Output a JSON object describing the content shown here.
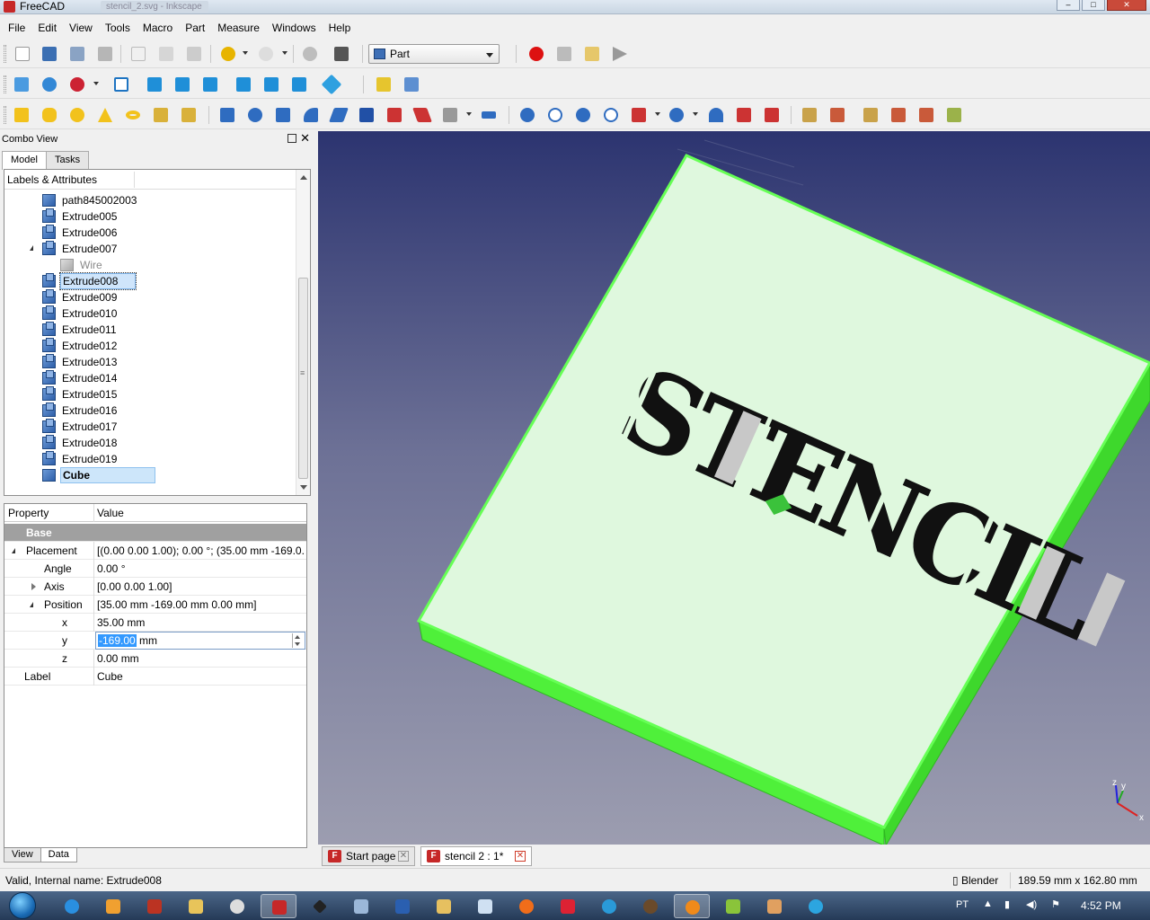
{
  "window": {
    "title": "FreeCAD",
    "ghost_tab": "stencil_2.svg - Inkscape"
  },
  "menu": [
    "File",
    "Edit",
    "View",
    "Tools",
    "Macro",
    "Part",
    "Measure",
    "Windows",
    "Help"
  ],
  "workbench": {
    "selected": "Part"
  },
  "combo": {
    "title": "Combo View",
    "tabs": [
      "Model",
      "Tasks"
    ],
    "tree_header": "Labels & Attributes",
    "tree": [
      {
        "label": "path845002003",
        "icon": "blue",
        "expander": "none"
      },
      {
        "label": "Extrude005",
        "icon": "extr",
        "expander": "closed"
      },
      {
        "label": "Extrude006",
        "icon": "extr",
        "expander": "closed"
      },
      {
        "label": "Extrude007",
        "icon": "extr",
        "expander": "open"
      },
      {
        "label": "Wire",
        "icon": "grey",
        "expander": "none",
        "indent": true
      },
      {
        "label": "Extrude008",
        "icon": "extr",
        "expander": "closed",
        "state": "outline"
      },
      {
        "label": "Extrude009",
        "icon": "extr",
        "expander": "closed"
      },
      {
        "label": "Extrude010",
        "icon": "extr",
        "expander": "closed"
      },
      {
        "label": "Extrude011",
        "icon": "extr",
        "expander": "closed"
      },
      {
        "label": "Extrude012",
        "icon": "extr",
        "expander": "closed"
      },
      {
        "label": "Extrude013",
        "icon": "extr",
        "expander": "closed"
      },
      {
        "label": "Extrude014",
        "icon": "extr",
        "expander": "closed"
      },
      {
        "label": "Extrude015",
        "icon": "extr",
        "expander": "closed"
      },
      {
        "label": "Extrude016",
        "icon": "extr",
        "expander": "closed"
      },
      {
        "label": "Extrude017",
        "icon": "extr",
        "expander": "closed"
      },
      {
        "label": "Extrude018",
        "icon": "extr",
        "expander": "closed"
      },
      {
        "label": "Extrude019",
        "icon": "extr",
        "expander": "closed"
      },
      {
        "label": "Cube",
        "icon": "blue",
        "expander": "none",
        "state": "selected"
      }
    ],
    "props": {
      "col_property": "Property",
      "col_value": "Value",
      "group": "Base",
      "placement_label": "Placement",
      "placement_value": "[(0.00 0.00 1.00); 0.00 °; (35.00 mm  -169.0...",
      "angle_label": "Angle",
      "angle_value": "0.00 °",
      "axis_label": "Axis",
      "axis_value": "[0.00 0.00 1.00]",
      "position_label": "Position",
      "position_value": "[35.00 mm  -169.00 mm  0.00 mm]",
      "x_label": "x",
      "x_value": "35.00 mm",
      "y_label": "y",
      "y_value_sel": "-169.00",
      "y_unit": " mm",
      "z_label": "z",
      "z_value": "0.00 mm",
      "label_label": "Label",
      "label_value": "Cube"
    },
    "bottom_tabs": [
      "View",
      "Data"
    ]
  },
  "view3d": {
    "stencil_text": "STENCIL",
    "axis_x": "x",
    "axis_y": "y",
    "axis_z": "z"
  },
  "doc_tabs": [
    {
      "label": "Start page"
    },
    {
      "label": "stencil 2 : 1*"
    }
  ],
  "status": {
    "message": "Valid, Internal name: Extrude008",
    "nav_style": "Blender",
    "dimensions": "189.59 mm x 162.80 mm"
  },
  "tray": {
    "lang": "PT",
    "time": "4:52 PM"
  },
  "colors": {
    "accent": "#3399ff",
    "cube_top": "#dff8de",
    "cube_edge": "#66ff55"
  }
}
